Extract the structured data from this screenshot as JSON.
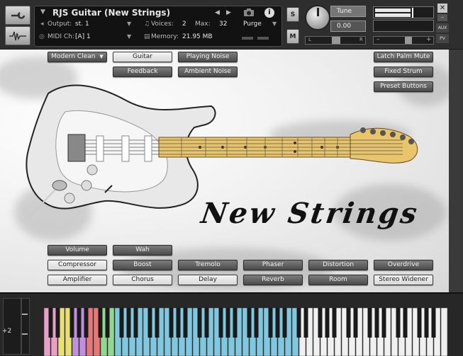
{
  "header": {
    "instrument_name": "RJS Guitar (New Strings)",
    "output_label": "Output:",
    "output_value": "st. 1",
    "midi_label": "MIDI Ch:",
    "midi_value": "[A]  1",
    "voices_label": "Voices:",
    "voices_value": "2",
    "max_label": "Max:",
    "max_value": "32",
    "purge_label": "Purge",
    "memory_label": "Memory:",
    "memory_value": "21.95 MB",
    "solo_label": "S",
    "mute_label": "M",
    "tune_label": "Tune",
    "tune_value": "0.00",
    "pan_left": "L",
    "pan_right": "R",
    "aux_label": "AUX",
    "pv_label": "PV"
  },
  "top_buttons": {
    "preset_select": "Modern Clean",
    "guitar": "Guitar",
    "playing_noise": "Playing Noise",
    "feedback": "Feedback",
    "ambient_noise": "Ambient Noise",
    "latch_palm_mute": "Latch Palm Mute",
    "fixed_strum": "Fixed Strum",
    "preset_buttons": "Preset Buttons"
  },
  "brand_text": "New Strings",
  "bottom_buttons": {
    "volume": "Volume",
    "wah": "Wah",
    "compressor": "Compressor",
    "boost": "Boost",
    "tremolo": "Tremolo",
    "phaser": "Phaser",
    "distortion": "Distortion",
    "overdrive": "Overdrive",
    "amplifier": "Amplifier",
    "chorus": "Chorus",
    "delay": "Delay",
    "reverb": "Reverb",
    "room": "Room",
    "stereo_widener": "Stereo Widener"
  },
  "keyboard": {
    "octave_value": "+2"
  },
  "colors": {
    "key_pink": "#e8a0c8",
    "key_yellow": "#e8e070",
    "key_purple": "#c090e0",
    "key_red": "#e87878",
    "key_green": "#90d890",
    "key_blue": "#80c8e0"
  }
}
